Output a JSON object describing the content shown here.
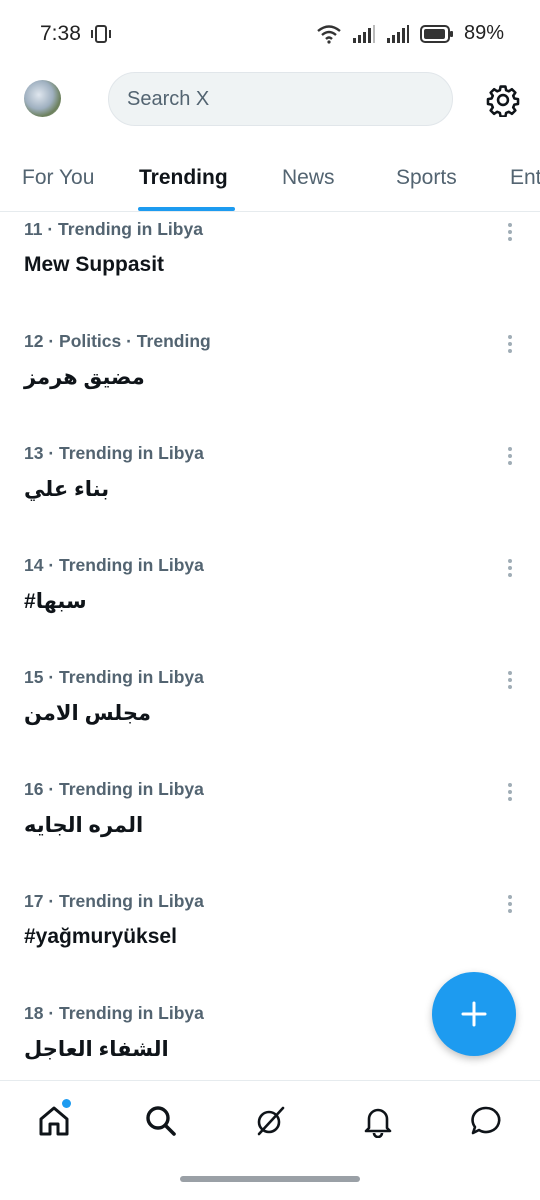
{
  "status_bar": {
    "time": "7:38",
    "battery": "89%"
  },
  "header": {
    "search_placeholder": "Search X"
  },
  "tabs": [
    {
      "label": "For You"
    },
    {
      "label": "Trending"
    },
    {
      "label": "News"
    },
    {
      "label": "Sports"
    },
    {
      "label": "Ent"
    }
  ],
  "active_tab": "Trending",
  "trends": [
    {
      "meta": "11 · Trending in Libya",
      "title": "Mew Suppasit"
    },
    {
      "meta": "12 · Politics · Trending",
      "title": "مضيق هرمز"
    },
    {
      "meta": "13 · Trending in Libya",
      "title": "بناء علي"
    },
    {
      "meta": "14 · Trending in Libya",
      "title": "#سبها"
    },
    {
      "meta": "15 · Trending in Libya",
      "title": "مجلس الامن"
    },
    {
      "meta": "16 · Trending in Libya",
      "title": "المره الجايه"
    },
    {
      "meta": "17 · Trending in Libya",
      "title": "#yağmuryüksel"
    },
    {
      "meta": "18 · Trending in Libya",
      "title": "الشفاء العاجل"
    }
  ],
  "colors": {
    "accent": "#1d9bf0",
    "text": "#0f1419",
    "muted": "#536471"
  },
  "nav": [
    {
      "icon": "home-icon"
    },
    {
      "icon": "search-icon"
    },
    {
      "icon": "grok-icon"
    },
    {
      "icon": "bell-icon"
    },
    {
      "icon": "messages-icon"
    }
  ]
}
